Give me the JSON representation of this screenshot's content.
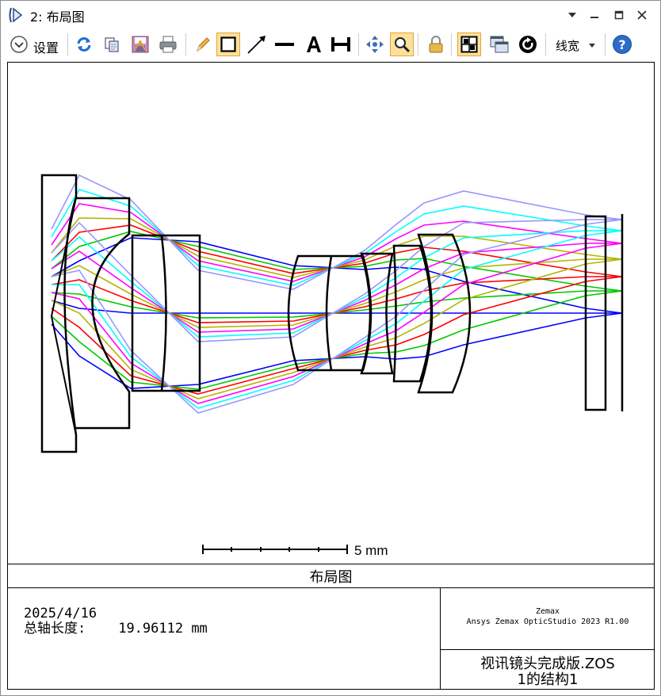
{
  "window": {
    "title": "2: 布局图"
  },
  "toolbar": {
    "settings_label": "设置",
    "linewidth_label": "线宽",
    "buttons": [
      "chevron-down-icon",
      "refresh-icon",
      "copy-icon",
      "save-icon",
      "print-icon",
      "pencil-icon",
      "rectangle-icon",
      "arrow-icon",
      "line-icon",
      "text-icon",
      "dimension-icon",
      "pan-icon",
      "zoom-icon",
      "lock-icon",
      "grid-icon",
      "window-icon",
      "rotate-icon",
      "help-icon"
    ]
  },
  "plot": {
    "scale_label": "5 mm",
    "caption": "布局图",
    "date": "2025/4/16",
    "total_axis_label": "总轴长度:",
    "total_axis_value": "19.96112 mm",
    "brand_line1": "Zemax",
    "brand_line2": "Ansys Zemax OpticStudio 2023 R1.00",
    "file_line1": "视讯镜头完成版.ZOS",
    "file_line2": "1的结构1",
    "field_colors": [
      "#0000ff",
      "#00c800",
      "#ff0000",
      "#b4b400",
      "#ff00ff",
      "#00ffff",
      "#9696ff"
    ]
  }
}
